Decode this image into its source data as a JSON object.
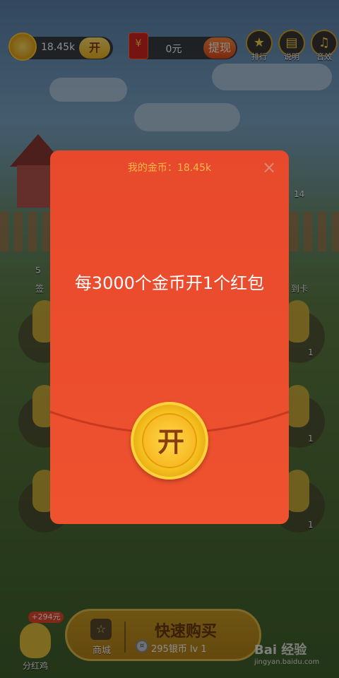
{
  "top_bar": {
    "coin_amount": "18.45k",
    "coin_open_label": "开",
    "cash_amount": "0元",
    "envelope_symbol": "¥",
    "withdraw_label": "提现",
    "icons": [
      {
        "name": "trophy-icon",
        "label": "排行"
      },
      {
        "name": "book-icon",
        "label": "说明"
      },
      {
        "name": "music-icon",
        "label": "音效"
      }
    ]
  },
  "side": {
    "left_badge": "5",
    "left_label": "签",
    "right_badge": "14",
    "right_label": "到卡",
    "tile_counts": [
      "1",
      "1",
      "1"
    ]
  },
  "modal": {
    "header": "我的金币：18.45k",
    "close_symbol": "×",
    "message": "每3000个金币开1个红包",
    "open_label": "开"
  },
  "bottom": {
    "dividend_badge": "+294元",
    "dividend_label": "分红鸡",
    "shop_label": "商城",
    "buy_title": "快速购买",
    "buy_sub": "295银币 lv 1",
    "watermark_main": "Bai 经验",
    "watermark_sub": "jingyan.baidu.com"
  },
  "colors": {
    "modal_red": "#ea4b2d",
    "header_orange": "#ffb84a",
    "coin_gold": "#f5c21f"
  }
}
